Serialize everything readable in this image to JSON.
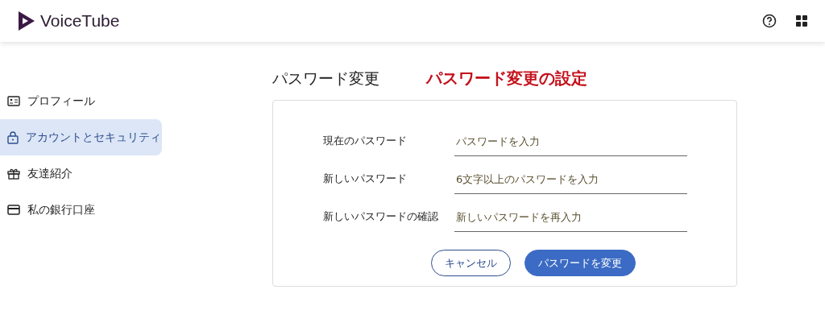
{
  "header": {
    "logo": "VoiceTube"
  },
  "sidebar": {
    "items": [
      {
        "label": "プロフィール",
        "selected": false
      },
      {
        "label": "アカウントとセキュリティ",
        "selected": true
      },
      {
        "label": "友達紹介",
        "selected": false
      },
      {
        "label": "私の銀行口座",
        "selected": false
      }
    ]
  },
  "page": {
    "title": "パスワード変更",
    "annotation": "パスワード変更の設定"
  },
  "form": {
    "fields": [
      {
        "label": "現在のパスワード",
        "placeholder": "パスワードを入力"
      },
      {
        "label": "新しいパスワード",
        "placeholder": "6文字以上のパスワードを入力"
      },
      {
        "label": "新しいパスワードの確認",
        "placeholder": "新しいパスワードを再入力"
      }
    ],
    "cancel": "キャンセル",
    "submit": "パスワードを変更"
  }
}
